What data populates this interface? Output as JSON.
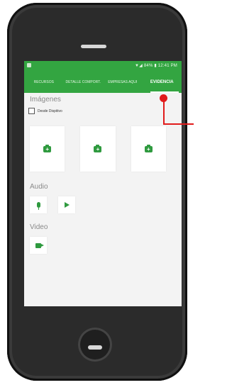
{
  "status": {
    "right_text": "▼◢ 84% ▮ 12:41 PM"
  },
  "tabs": [
    {
      "label": "RECURSOS"
    },
    {
      "label": "DETALLE COMPORT."
    },
    {
      "label": "EMPRESAS AQUI"
    },
    {
      "label": "EVIDENCIA"
    }
  ],
  "images": {
    "title": "Imágenes",
    "checkbox_label": "Desde Dispitivo",
    "cards": [
      {
        "icon": "camera-add-icon"
      },
      {
        "icon": "camera-add-icon"
      },
      {
        "icon": "camera-add-icon"
      }
    ]
  },
  "audio": {
    "title": "Audio",
    "buttons": [
      {
        "icon": "mic-icon"
      },
      {
        "icon": "play-icon"
      }
    ]
  },
  "video": {
    "title": "Video",
    "buttons": [
      {
        "icon": "video-camera-icon"
      }
    ]
  },
  "colors": {
    "primary": "#33a541",
    "accent": "#e11b1b"
  }
}
